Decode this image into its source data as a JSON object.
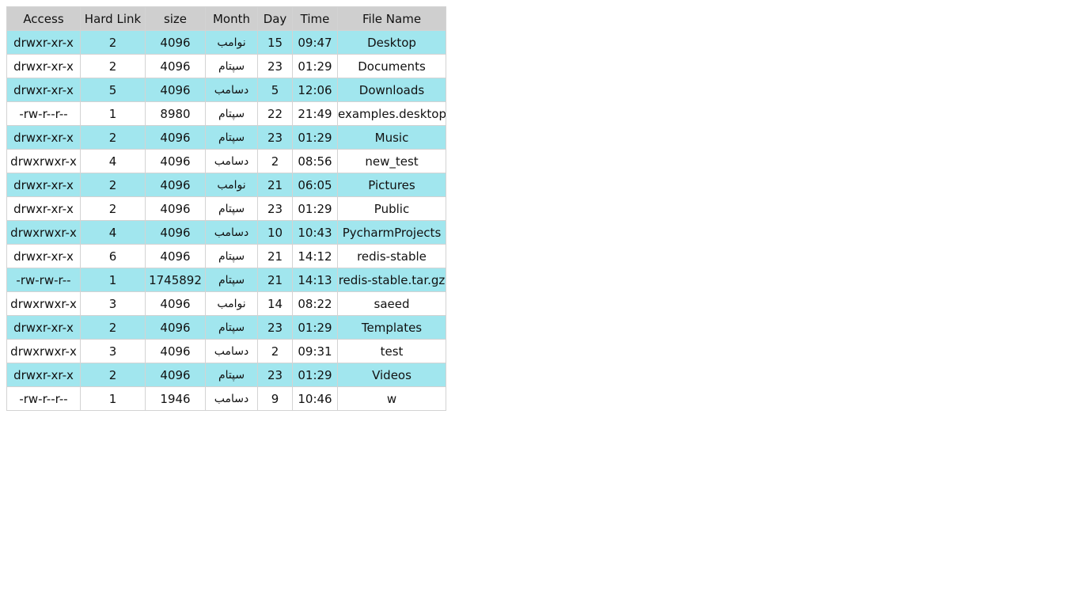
{
  "table": {
    "columns": [
      "Access",
      "Hard Link",
      "size",
      "Month",
      "Day",
      "Time",
      "File Name"
    ],
    "rows": [
      [
        "drwxr-xr-x",
        "2",
        "4096",
        "نوامب",
        "15",
        "09:47",
        "Desktop"
      ],
      [
        "drwxr-xr-x",
        "2",
        "4096",
        "سپتام",
        "23",
        "01:29",
        "Documents"
      ],
      [
        "drwxr-xr-x",
        "5",
        "4096",
        "دسامب",
        "5",
        "12:06",
        "Downloads"
      ],
      [
        "-rw-r--r--",
        "1",
        "8980",
        "سپتام",
        "22",
        "21:49",
        "examples.desktop"
      ],
      [
        "drwxr-xr-x",
        "2",
        "4096",
        "سپتام",
        "23",
        "01:29",
        "Music"
      ],
      [
        "drwxrwxr-x",
        "4",
        "4096",
        "دسامب",
        "2",
        "08:56",
        "new_test"
      ],
      [
        "drwxr-xr-x",
        "2",
        "4096",
        "نوامب",
        "21",
        "06:05",
        "Pictures"
      ],
      [
        "drwxr-xr-x",
        "2",
        "4096",
        "سپتام",
        "23",
        "01:29",
        "Public"
      ],
      [
        "drwxrwxr-x",
        "4",
        "4096",
        "دسامب",
        "10",
        "10:43",
        "PycharmProjects"
      ],
      [
        "drwxr-xr-x",
        "6",
        "4096",
        "سپتام",
        "21",
        "14:12",
        "redis-stable"
      ],
      [
        "-rw-rw-r--",
        "1",
        "1745892",
        "سپتام",
        "21",
        "14:13",
        "redis-stable.tar.gz"
      ],
      [
        "drwxrwxr-x",
        "3",
        "4096",
        "نوامب",
        "14",
        "08:22",
        "saeed"
      ],
      [
        "drwxr-xr-x",
        "2",
        "4096",
        "سپتام",
        "23",
        "01:29",
        "Templates"
      ],
      [
        "drwxrwxr-x",
        "3",
        "4096",
        "دسامب",
        "2",
        "09:31",
        "test"
      ],
      [
        "drwxr-xr-x",
        "2",
        "4096",
        "سپتام",
        "23",
        "01:29",
        "Videos"
      ],
      [
        "-rw-r--r--",
        "1",
        "1946",
        "دسامب",
        "9",
        "10:46",
        "w"
      ]
    ]
  },
  "colors": {
    "header_bg": "#cfcfcf",
    "odd_row_bg": "#a1e6ee",
    "even_row_bg": "#ffffff",
    "border": "#d3d3d3"
  }
}
